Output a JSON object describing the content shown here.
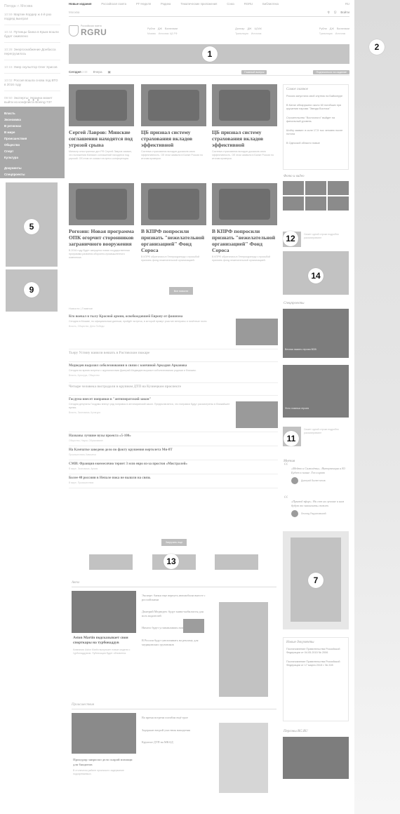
{
  "left": {
    "city": "Погода: г. Москва",
    "news": [
      {
        "time": "10:59",
        "text": "Мартин Кордер ж 4-й раз подряд выиграл "
      },
      {
        "time": "10:44",
        "text": "Путинцы банка в Крым вошли будет оживлено"
      },
      {
        "time": "10:28",
        "text": "Энергоснабжение Донбасса перегрузилось"
      },
      {
        "time": "10:15",
        "text": "Умер скульптор Олег Хрисов"
      },
      {
        "time": "10:02",
        "text": "Россия вошла снова под ВТО в 2016 году"
      },
      {
        "time": "09:50",
        "text": "Эксперты: Украина может выйти из конфликта Boeing-737"
      }
    ],
    "more": "• • •",
    "categories": [
      "Власть",
      "Экономика",
      "В регионах",
      "В мире",
      "Происшествия",
      "Общество",
      "Спорт",
      "Культура",
      "Документы",
      "Спецпроекты"
    ]
  },
  "nav": {
    "items": [
      "Новые издания",
      "Российская газета",
      "РГ-Неделя",
      "Родина",
      "Тематические приложения",
      "Союз",
      "RGRU",
      "Библиотека"
    ],
    "right": "RU",
    "search_placeholder": "Москва",
    "login": "Войти"
  },
  "brand": {
    "small": "Российская газета",
    "name": "RGRU"
  },
  "ticker": [
    {
      "a": "Рубли",
      "b": "ДЖ",
      "c": "Валютами",
      "sub": "Москва",
      "sub2": "Источник: ЦБ РФ"
    },
    {
      "a": "Доллар",
      "b": "ДЖ",
      "c": "ЦОАК",
      "sub": "Трансляция",
      "sub2": "Источник"
    },
    {
      "a": "Рубли",
      "b": "ДЖ",
      "c": "Валютами",
      "sub": "Трансляция",
      "sub2": "Источник"
    }
  ],
  "tabs": {
    "today": "Сегодня",
    "today_count": "248",
    "second": "Вчера",
    "filter_btn": "Главный выпуск",
    "right_btn": "Подписаться на издание"
  },
  "articles": [
    {
      "title": "Сергей Лавров: Минские соглашения находятся под угрозой срыва",
      "desc": "Министр иностранных дел РФ Сергей Лавров заявил, что положения Минских соглашений находятся под угрозой. Об этом он сказал на пресс-конференции."
    },
    {
      "title": "ЦБ признал систему страхования вкладов эффективной",
      "desc": "Система страхования вкладов доказала свою эффективность. Об этом заявили в Банке России по итогам проверки."
    },
    {
      "title": "ЦБ признал систему страхования вкладов эффективной",
      "desc": "Система страхования вкладов доказала свою эффективность. Об этом заявили в Банке России по итогам проверки."
    },
    {
      "title": "Рогозин: Новая программа ОПК огорчит сторонников заграничного вооружения",
      "desc": "В 2016 году будет запущена новая государственная программа развития оборонно-промышленного комплекса."
    },
    {
      "title": "В КПРФ попросили признать \"нежелательной организацией\" Фонд Сороса",
      "desc": "В КПРФ обратились в Генпрокуратуру с просьбой признать фонд нежелательной организацией."
    },
    {
      "title": "В КПРФ попросили признать \"нежелательной организацией\" Фонд Сороса",
      "desc": "В КПРФ обратились в Генпрокуратуру с просьбой признать фонд нежелательной организацией."
    }
  ],
  "all_news": "Все новости",
  "right": {
    "box_title": "Самое главное",
    "box_items": [
      "Россия запустила свой спутник на Байконуре",
      "В Китае обнаружили около 60 погибших при крушении парома \"Звезда Востока\"",
      "Строительство \"Восточного\" выйдет на финальный уровень",
      "Шойгу заявил: в силе 17,5 тыс человек после потопа",
      "В Одесской области новые"
    ],
    "photo_title": "Фото и видео",
    "specials_title": "Спецпроекты",
    "special1": "Вечная память героям ВОВ",
    "special2": "Фото главных героев",
    "quotes_title": "Мнения",
    "quote1": "«Мейто и Самолёты». Интервенция и Ю. Будет в плане: Газ в краю",
    "author1": "Дмитрий Валентинов",
    "quote2": "«Прямой эфир». Ни сот ни лучшие и нам будут то закончить сюжет.",
    "author2": "Леонид Радзиховский",
    "docs_title": "Новые документы",
    "docs": [
      "Постановление Правительства Российской Федерации от 04.05.2015 № 2006",
      "Постановление Правительства Российской Федерации от 17 марта 2015 г. № 228"
    ],
    "bottom_title": "Персоны RG.RU"
  },
  "feed": {
    "header": "Новости | Главное",
    "items": [
      {
        "title": "Кто воевал в тылу Красной армии, освобождавшей Европу от фашизма",
        "text": "Сегодня в Москве, по официальным данным, пройдёт встреча, в которой примут участие ветераны и почётные гости.",
        "meta": "Власть, Общество, День Победы",
        "light": false,
        "thumb": true
      },
      {
        "title": "Тьеру Устину нанили вешать в Ростовском пожаре",
        "text": "",
        "meta": "",
        "light": true,
        "thumb": false
      },
      {
        "title": "Медведев выразил соболезнования в связи с кончиной Аркадия Арканова",
        "text": "Сегодня во время встречи с журналистами Дмитрий Медведев выразил соболезнования родным и близким.",
        "meta": "Власть, Культура, Общество",
        "light": false,
        "thumb": false
      },
      {
        "title": "Четыре человека пострадали в крупном ДТП на Кузнецком проспекте",
        "text": "",
        "meta": "",
        "light": true,
        "thumb": false
      },
      {
        "title": "Госдума внесет поправки в \"антипиратский закон\"",
        "text": "Сегодня депутаты Госдумы внесут ряд поправок в антипиратский закон. Предполагается, что поправки будут рассмотрены в ближайшее время.",
        "meta": "Власть, Экономика, Культура",
        "light": false,
        "thumb": true
      },
      {
        "title": "Названы лучшие вузы проекта «5-100»",
        "text": "",
        "meta": "Общество, Наука, Образование",
        "light": false,
        "thumb": false
      },
      {
        "title": "На Камчатке заведено дело по факту крушения вертолета Ми-8Т",
        "text": "",
        "meta": "Происшествия, Камчатка",
        "light": false,
        "thumb": false
      },
      {
        "title": "СМИ: Франция ежемесячно теряет 3 млн евро из-за простоя «Мистралей»",
        "text": "",
        "meta": "В мире, Экономика, Армия",
        "light": false,
        "thumb": false
      },
      {
        "title": "Более 40 россиян в Непале пока не вышли на связь",
        "text": "",
        "meta": "В мире, Происшествия",
        "light": false,
        "thumb": false
      }
    ]
  },
  "load_more": "Загрузить еще",
  "auto": {
    "title": "Авто",
    "lead_title": "Aston Martin подсказывает свои спорткары на турбонаддув",
    "lead_text": "Компания Aston Martin выпускает новые модели с турбонаддувом. Публикация будет обновлена.",
    "mid": [
      "Эксперт: банки еще вернуть автомобили вместе с российскими",
      "Дмитрий Медведев: будут мини-мобилисты для всех водителей",
      "Ничего будет устанавливать новые машины",
      "В России будут увеличивать на рекламу для медицинских грузовиков"
    ]
  },
  "incidents": {
    "title": "Происшествия",
    "lead_title": "Прокурор запросил дело скорой помощи для бандитов",
    "lead_text": "В столичном районе произошло задержание подозреваемых.",
    "mid": [
      "Во время встречи погибли ещё трое",
      "Задержан второй участник нападения",
      "Крупное ДТП на МКАД"
    ]
  },
  "badges": [
    "1",
    "2",
    "5",
    "7",
    "9",
    "11",
    "12",
    "13",
    "14"
  ]
}
